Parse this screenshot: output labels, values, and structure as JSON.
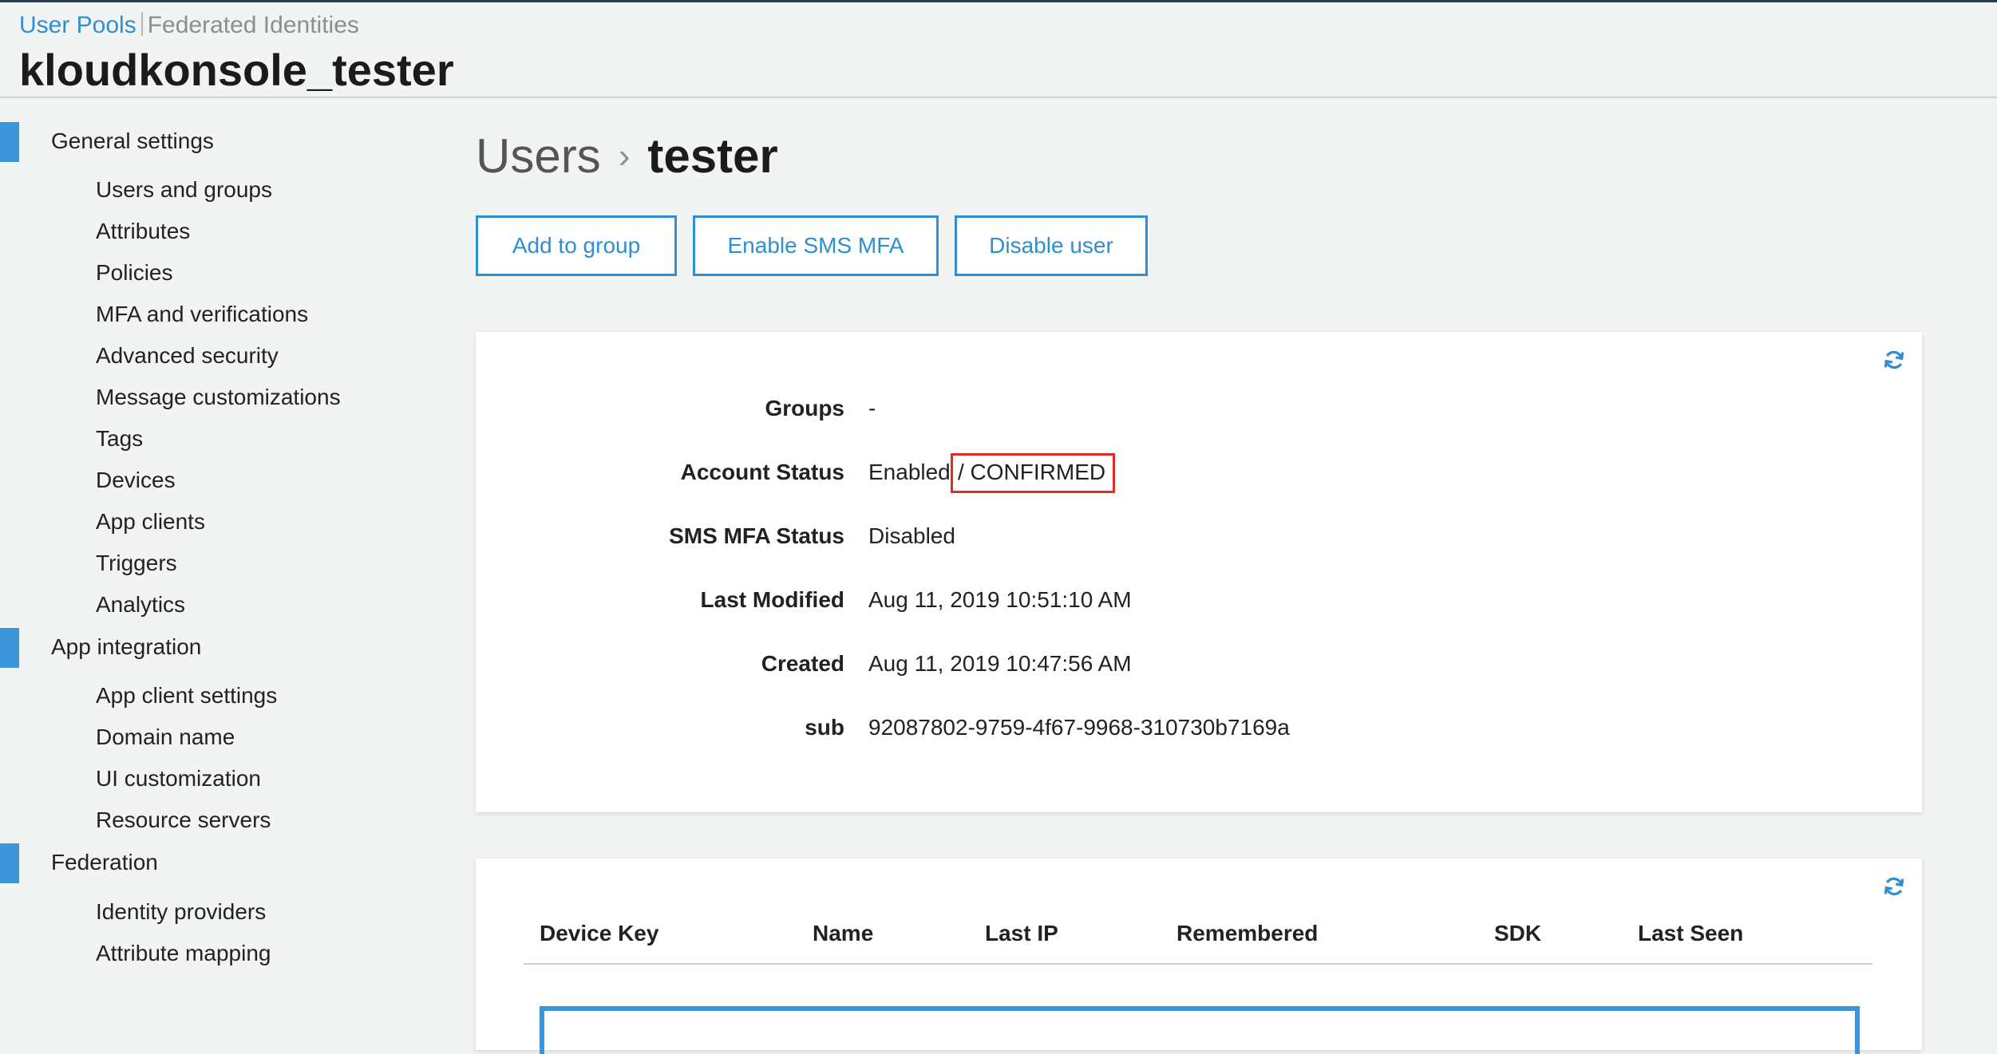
{
  "breadcrumb": {
    "active": "User Pools",
    "other": "Federated Identities"
  },
  "pool_name": "kloudkonsole_tester",
  "sidebar": {
    "general": {
      "title": "General settings",
      "items": [
        "Users and groups",
        "Attributes",
        "Policies",
        "MFA and verifications",
        "Advanced security",
        "Message customizations",
        "Tags",
        "Devices",
        "App clients",
        "Triggers",
        "Analytics"
      ]
    },
    "app_integration": {
      "title": "App integration",
      "items": [
        "App client settings",
        "Domain name",
        "UI customization",
        "Resource servers"
      ]
    },
    "federation": {
      "title": "Federation",
      "items": [
        "Identity providers",
        "Attribute mapping"
      ]
    }
  },
  "page": {
    "parent": "Users",
    "separator": "›",
    "user": "tester"
  },
  "actions": {
    "add_to_group": "Add to group",
    "enable_sms_mfa": "Enable SMS MFA",
    "disable_user": "Disable user"
  },
  "details": {
    "groups_label": "Groups",
    "groups_value": "-",
    "status_label": "Account Status",
    "status_enabled": "Enabled",
    "status_confirmed": "/ CONFIRMED",
    "sms_label": "SMS MFA Status",
    "sms_value": "Disabled",
    "modified_label": "Last Modified",
    "modified_value": "Aug 11, 2019 10:51:10 AM",
    "created_label": "Created",
    "created_value": "Aug 11, 2019 10:47:56 AM",
    "sub_label": "sub",
    "sub_value": "92087802-9759-4f67-9968-310730b7169a"
  },
  "devices_table": {
    "columns": [
      "Device Key",
      "Name",
      "Last IP",
      "Remembered",
      "SDK",
      "Last Seen"
    ],
    "rows": []
  },
  "icons": {
    "refresh": "refresh-icon"
  },
  "colors": {
    "accent": "#2e8fd3",
    "highlight": "#e02b26",
    "section_bar": "#3b95d8"
  }
}
